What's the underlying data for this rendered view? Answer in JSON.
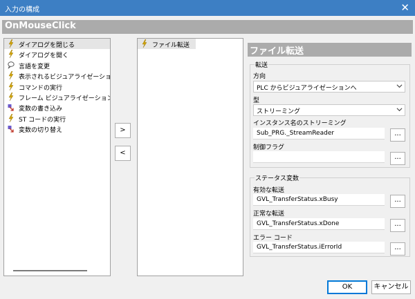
{
  "window": {
    "title": "入力の構成",
    "close_glyph": "✕"
  },
  "event_name": "OnMouseClick",
  "actions_list": [
    {
      "label": "ダイアログを閉じる",
      "icon": "lightning-icon",
      "selected": true
    },
    {
      "label": "ダイアログを開く",
      "icon": "lightning-icon"
    },
    {
      "label": "言語を変更",
      "icon": "speech-icon"
    },
    {
      "label": "表示されるビジュアライゼーションを変",
      "icon": "lightning-icon"
    },
    {
      "label": "コマンドの実行",
      "icon": "lightning-icon"
    },
    {
      "label": "フレーム ビジュアライゼーションの切り",
      "icon": "lightning-icon"
    },
    {
      "label": "変数の書き込み",
      "icon": "variable-arrow-icon"
    },
    {
      "label": "ST コードの実行",
      "icon": "lightning-icon"
    },
    {
      "label": "変数の切り替え",
      "icon": "variable-arrow-icon"
    }
  ],
  "buttons": {
    "add": ">",
    "remove": "<",
    "ok": "OK",
    "cancel": "キャンセル",
    "browse": "..."
  },
  "configured_actions": [
    {
      "label": "ファイル転送",
      "icon": "lightning-icon"
    }
  ],
  "detail": {
    "title": "ファイル転送",
    "transfer_group": "転送",
    "direction_label": "方向",
    "direction_value": "PLC からビジュアライゼーションへ",
    "type_label": "型",
    "type_value": "ストリーミング",
    "instance_label": "インスタンス名のストリーミング",
    "instance_value": "Sub_PRG._StreamReader",
    "control_flag_label": "制御フラグ",
    "control_flag_value": "",
    "status_group": "ステータス変数",
    "active_label": "有効な転送",
    "active_value": "GVL_TransferStatus.xBusy",
    "success_label": "正常な転送",
    "success_value": "GVL_TransferStatus.xDone",
    "error_label": "エラー コード",
    "error_value": "GVL_TransferStatus.iErrorId"
  },
  "colors": {
    "title_bar": "#3d7fc4",
    "header_bar": "#ababab",
    "lightning": "#d4a500"
  }
}
